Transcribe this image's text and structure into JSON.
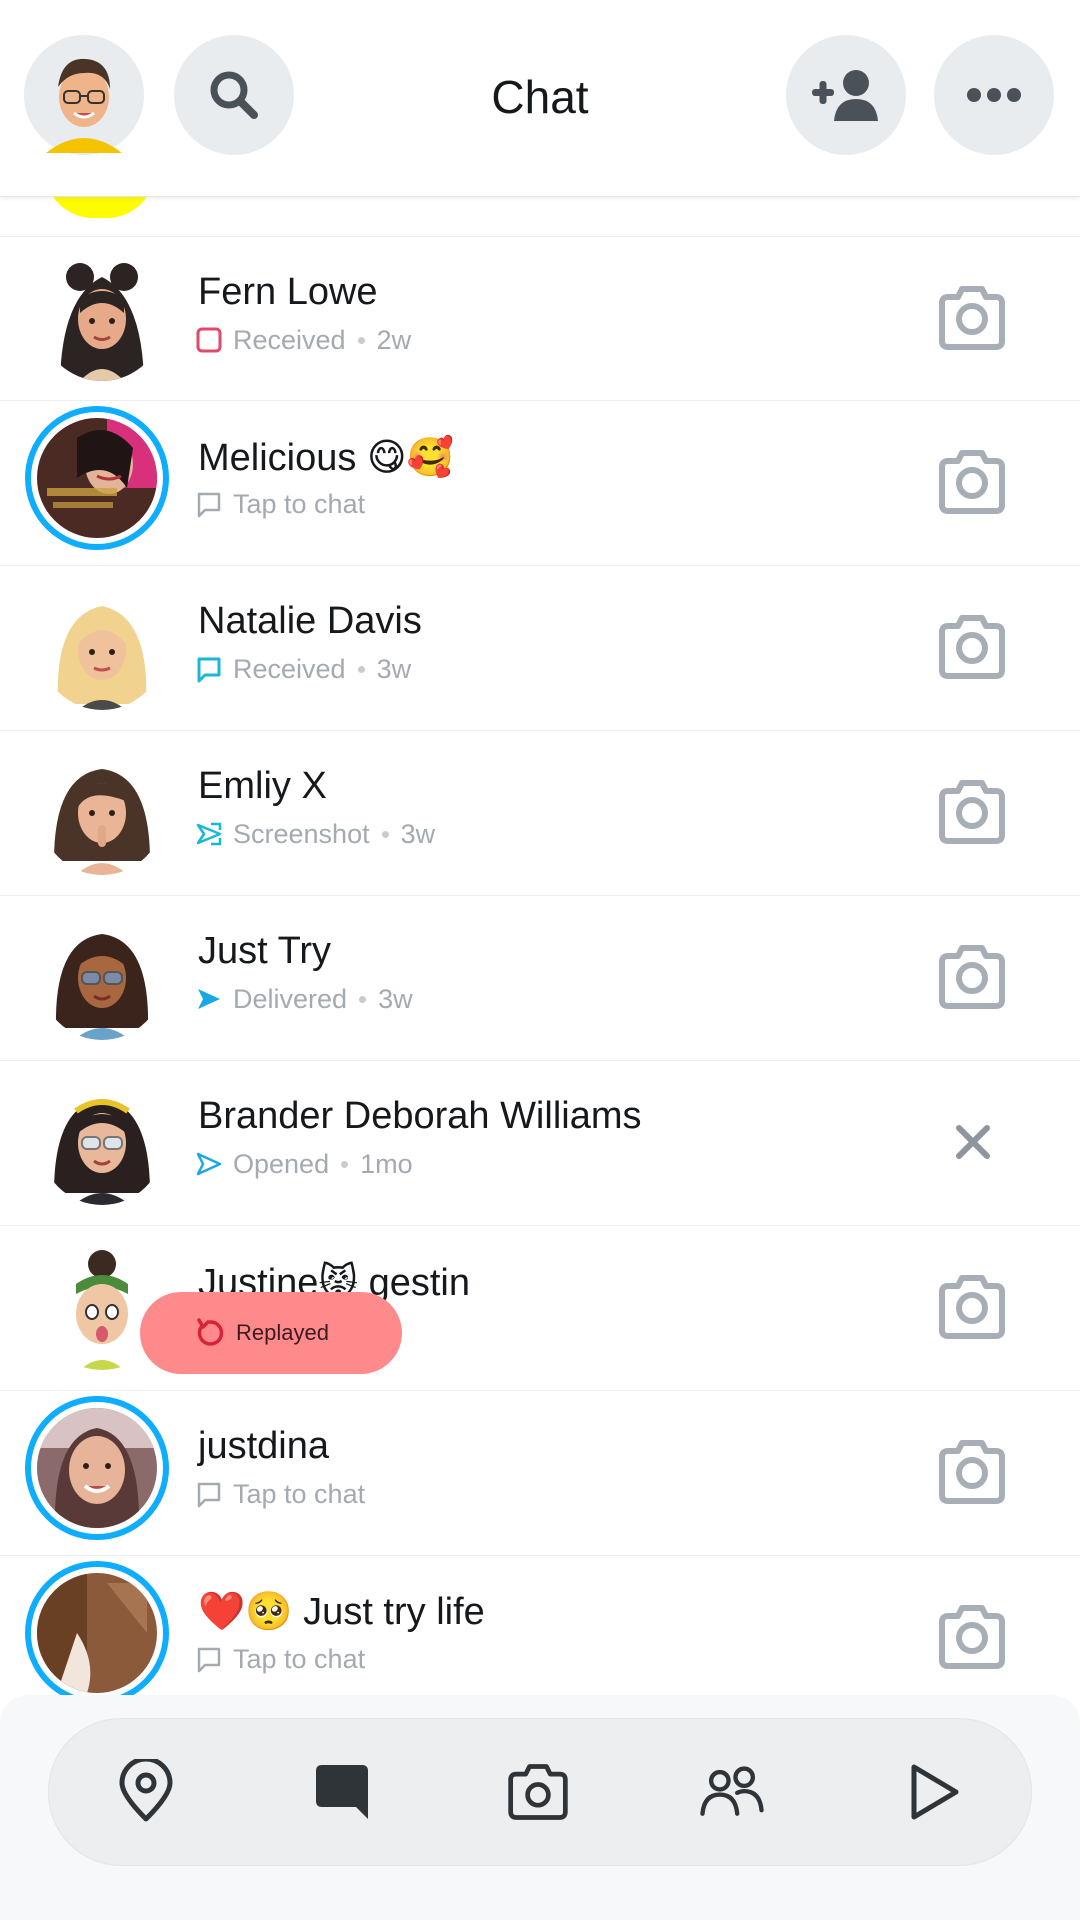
{
  "header": {
    "title": "Chat",
    "icons": {
      "profile": "bitmoji-avatar",
      "search": "search-icon",
      "add_friend": "add-friend-icon",
      "more": "more-icon"
    }
  },
  "colors": {
    "accent_blue": "#0fadff",
    "received_red": "#e4476a",
    "received_teal": "#19b8d9",
    "replayed_bg": "#ff8a8c",
    "icon_gray": "#a8aeb5"
  },
  "chats": [
    {
      "name": "Fern Lowe",
      "status": "Received",
      "time": "2w",
      "status_icon": "received-snap-icon",
      "action": "camera-icon",
      "story_ring": false
    },
    {
      "name": "Melicious 😋🥰",
      "status": "Tap to chat",
      "time": "",
      "status_icon": "chat-bubble-icon",
      "action": "camera-icon",
      "story_ring": true
    },
    {
      "name": "Natalie Davis",
      "status": "Received",
      "time": "3w",
      "status_icon": "received-chat-icon",
      "action": "camera-icon",
      "story_ring": false
    },
    {
      "name": "Emliy X",
      "status": "Screenshot",
      "time": "3w",
      "status_icon": "screenshot-icon",
      "action": "camera-icon",
      "story_ring": false
    },
    {
      "name": "Just Try",
      "status": "Delivered",
      "time": "3w",
      "status_icon": "delivered-arrow-icon",
      "action": "camera-icon",
      "story_ring": false
    },
    {
      "name": "Brander Deborah Williams",
      "status": "Opened",
      "time": "1mo",
      "status_icon": "opened-arrow-icon",
      "action": "close-icon",
      "story_ring": false
    },
    {
      "name": "Justine😾 gestin",
      "status": "",
      "time": "",
      "status_icon": "",
      "action": "camera-icon",
      "story_ring": false
    },
    {
      "name": "justdina",
      "status": "Tap to chat",
      "time": "",
      "status_icon": "chat-bubble-icon",
      "action": "camera-icon",
      "story_ring": true
    },
    {
      "name": "❤️🥺 Just try life",
      "status": "Tap to chat",
      "time": "",
      "status_icon": "chat-bubble-icon",
      "action": "camera-icon",
      "story_ring": true
    }
  ],
  "toast": {
    "label": "Replayed",
    "icon": "replay-icon"
  },
  "nav": [
    {
      "name": "map",
      "icon": "map-pin-icon"
    },
    {
      "name": "chat",
      "icon": "chat-icon",
      "active": true
    },
    {
      "name": "camera",
      "icon": "camera-icon"
    },
    {
      "name": "stories",
      "icon": "friends-icon"
    },
    {
      "name": "spotlight",
      "icon": "play-icon"
    }
  ]
}
